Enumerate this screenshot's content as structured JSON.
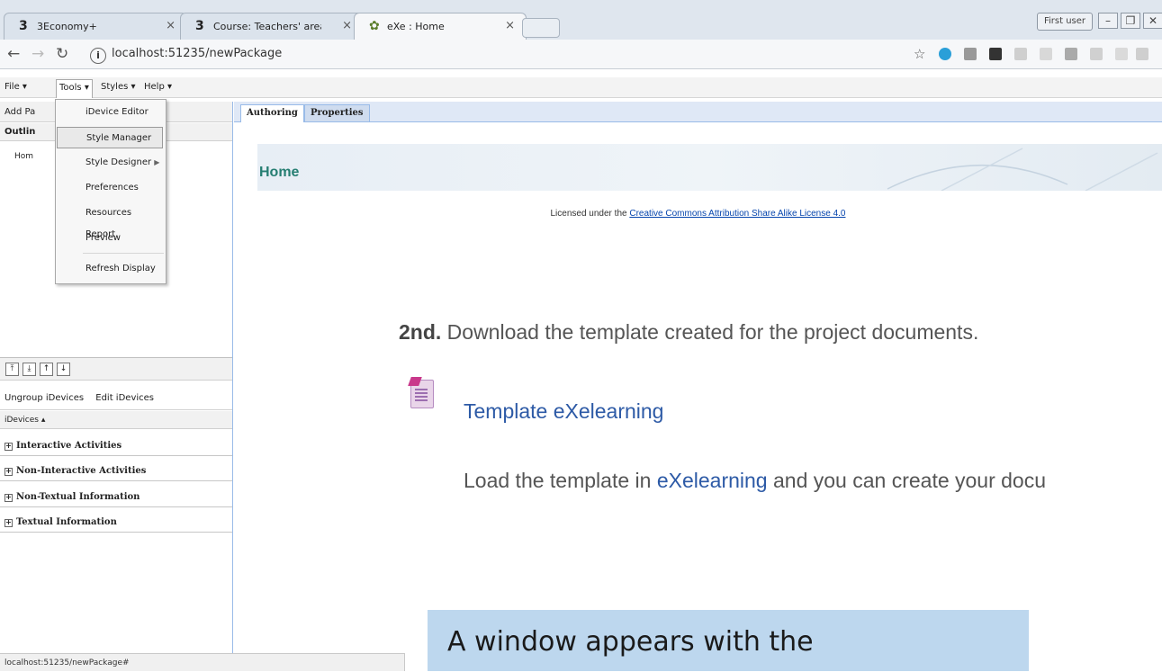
{
  "browser": {
    "tabs": [
      {
        "title": "3Economy+",
        "icon": "three-economy-icon"
      },
      {
        "title": "Course: Teachers' area",
        "icon": "three-economy-icon"
      },
      {
        "title": "eXe : Home",
        "icon": "exe-icon"
      }
    ],
    "user_button": "First user",
    "url": "localhost:51235/newPackage"
  },
  "menubar": {
    "items": [
      "File ▾",
      "Tools ▾",
      "Styles ▾",
      "Help ▾"
    ]
  },
  "tools_menu": {
    "items": [
      "iDevice Editor",
      "Style Manager",
      "Style Designer",
      "Preferences",
      "Resources Report",
      "Preview",
      "Refresh Display"
    ]
  },
  "left_panel": {
    "add_page": "Add Pa",
    "outline": "Outlin",
    "tree_item": "Hom",
    "ungroup_idevices": "Ungroup iDevices",
    "edit_idevices": "Edit iDevices",
    "idevices_header": "iDevices ▴",
    "categories": [
      "Interactive Activities",
      "Non-Interactive Activities",
      "Non-Textual Information",
      "Textual Information"
    ]
  },
  "right_panel": {
    "tabs": [
      "Authoring",
      "Properties"
    ],
    "home_title": "Home",
    "license_prefix": "Licensed under the",
    "license_link": "Creative Commons Attribution Share Alike License 4.0",
    "step_bold": "2nd.",
    "step_text": "Download the template created for the project documents.",
    "template_link": "Template eXelearning",
    "load_prefix": "Load the template in",
    "load_highlight": "eXelearning",
    "load_suffix": "and you can create your docu"
  },
  "caption": "A window appears with the",
  "status_bar": "localhost:51235/newPackage#",
  "colors": {
    "home_title": "#267e72",
    "link_blue": "#2d5aa6",
    "caption_bg": "#bdd7ee"
  }
}
